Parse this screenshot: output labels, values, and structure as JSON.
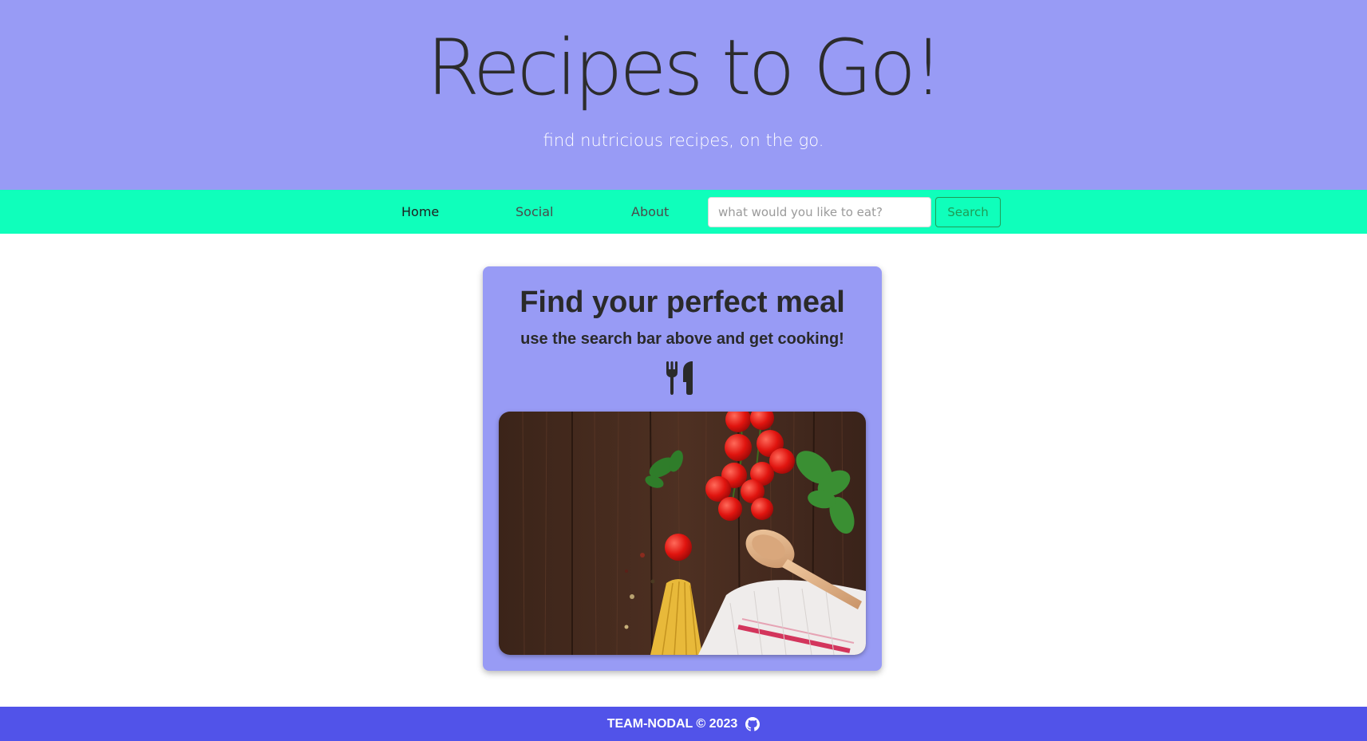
{
  "hero": {
    "title": "Recipes to Go!",
    "subtitle": "find nutricious recipes, on the go."
  },
  "nav": {
    "items": [
      {
        "label": "Home",
        "active": true
      },
      {
        "label": "Social",
        "active": false
      },
      {
        "label": "About",
        "active": false
      }
    ],
    "search": {
      "placeholder": "what would you like to eat?",
      "value": "",
      "button_label": "Search"
    }
  },
  "card": {
    "title": "Find your perfect meal",
    "subtitle": "use the search bar above and get cooking!",
    "icon": "utensils-icon",
    "image": "food-photo"
  },
  "footer": {
    "text": "TEAM-NODAL © 2023",
    "icon": "github-icon"
  },
  "colors": {
    "hero_bg": "#989bf5",
    "nav_bg": "#0fffbb",
    "card_bg": "#989bf5",
    "footer_bg": "#5153e9",
    "search_accent": "#1f9c55"
  }
}
